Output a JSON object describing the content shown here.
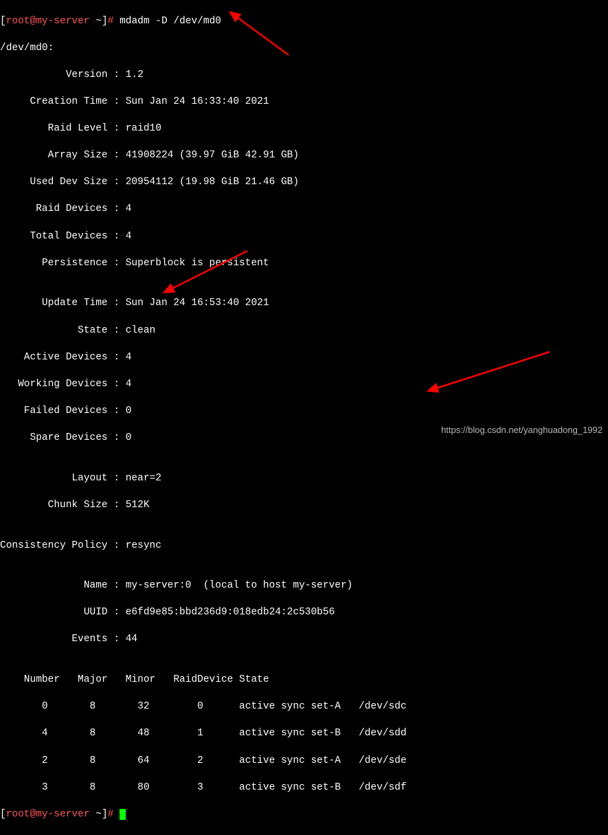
{
  "topcut": "active sync set-B   /dev/sdf",
  "prompt": {
    "open": "[",
    "user": "root",
    "at": "@",
    "host": "my-server",
    "path": " ~",
    "close": "]",
    "hash": "# "
  },
  "command": "mdadm -D /dev/md0",
  "device_line": "/dev/md0:",
  "info": {
    "version": "           Version : 1.2",
    "creation_time": "     Creation Time : Sun Jan 24 16:33:40 2021",
    "raid_level": "        Raid Level : raid10",
    "array_size": "        Array Size : 41908224 (39.97 GiB 42.91 GB)",
    "used_dev_size": "     Used Dev Size : 20954112 (19.98 GiB 21.46 GB)",
    "raid_devices": "      Raid Devices : 4",
    "total_devices": "     Total Devices : 4",
    "persistence": "       Persistence : Superblock is persistent",
    "blank1": "",
    "update_time": "       Update Time : Sun Jan 24 16:53:40 2021",
    "state": "             State : clean",
    "active_devices": "    Active Devices : 4",
    "working_devices": "   Working Devices : 4",
    "failed_devices": "    Failed Devices : 0",
    "spare_devices": "     Spare Devices : 0",
    "blank2": "",
    "layout": "            Layout : near=2",
    "chunk_size": "        Chunk Size : 512K",
    "blank3": "",
    "consistency": "Consistency Policy : resync",
    "blank4": "",
    "name": "              Name : my-server:0  (local to host my-server)",
    "uuid": "              UUID : e6fd9e85:bbd236d9:018edb24:2c530b56",
    "events": "            Events : 44",
    "blank5": ""
  },
  "table": {
    "header": "    Number   Major   Minor   RaidDevice State",
    "rows": [
      "       0       8       32        0      active sync set-A   /dev/sdc",
      "       4       8       48        1      active sync set-B   /dev/sdd",
      "       2       8       64        2      active sync set-A   /dev/sde",
      "       3       8       80        3      active sync set-B   /dev/sdf"
    ]
  },
  "watermark": "https://blog.csdn.net/yanghuadong_1992"
}
